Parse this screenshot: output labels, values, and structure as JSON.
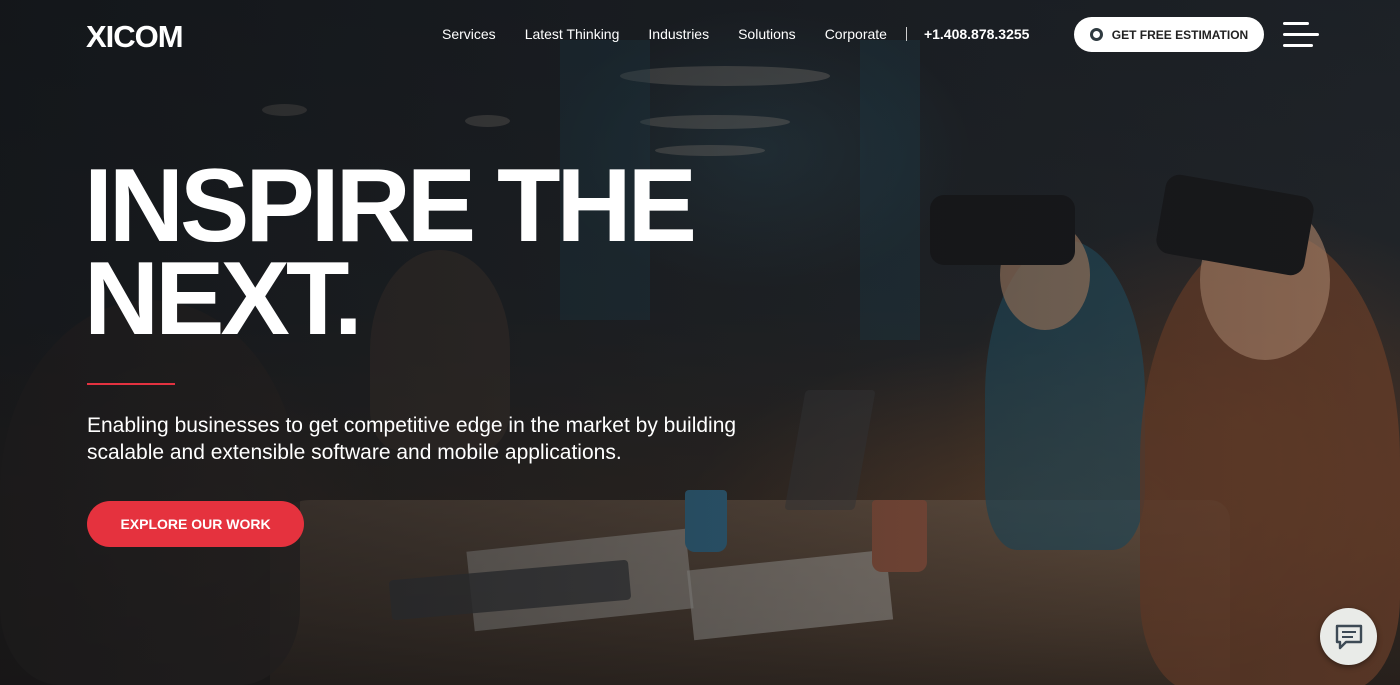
{
  "brand": {
    "logo_text": "XICOM"
  },
  "nav": {
    "items": [
      {
        "label": "Services"
      },
      {
        "label": "Latest Thinking"
      },
      {
        "label": "Industries"
      },
      {
        "label": "Solutions"
      },
      {
        "label": "Corporate"
      }
    ],
    "phone": "+1.408.878.3255",
    "cta_label": "GET FREE ESTIMATION",
    "menu_icon": "hamburger-icon"
  },
  "hero": {
    "headline_line1": "INSPIRE THE",
    "headline_line2": "NEXT.",
    "subheadline": "Enabling businesses to get competitive edge in the market by building scalable and extensible software and mobile applications.",
    "button_label": "EXPLORE OUR WORK"
  },
  "chat": {
    "icon": "chat-icon"
  },
  "colors": {
    "accent": "#e5323e",
    "text": "#ffffff",
    "button_light": "#ffffff"
  }
}
